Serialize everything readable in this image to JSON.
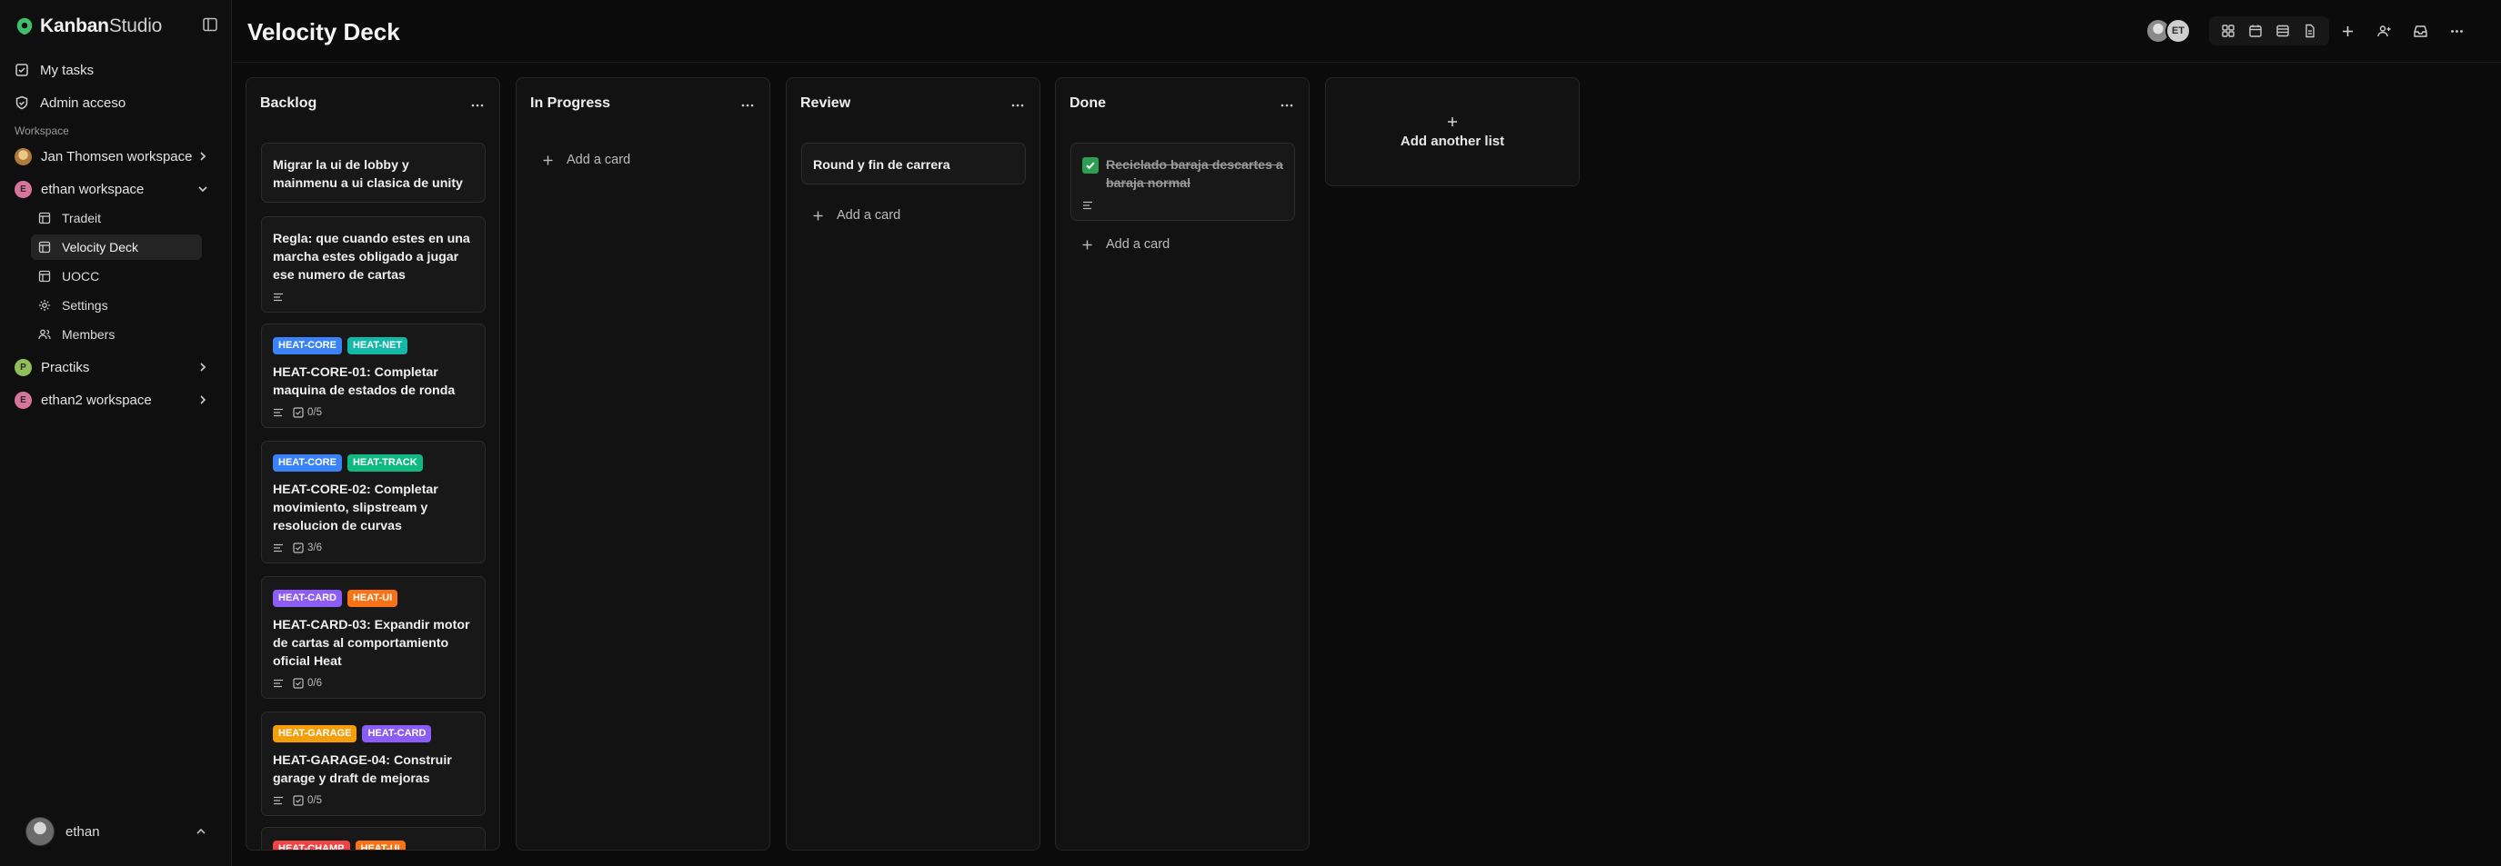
{
  "app": {
    "brand_bold": "Kanban",
    "brand_light": "Studio"
  },
  "sidebar": {
    "nav": [
      {
        "label": "My tasks",
        "icon": "check-square-icon"
      },
      {
        "label": "Admin acceso",
        "icon": "shield-icon"
      }
    ],
    "section_label": "Workspace",
    "workspaces": [
      {
        "label": "Jan Thomsen workspace",
        "initial": "",
        "color": "#d9a85b"
      },
      {
        "label": "ethan workspace",
        "initial": "E",
        "color": "#d8769a",
        "expanded": true
      },
      {
        "label": "Practiks",
        "initial": "P",
        "color": "#8fbf5a"
      },
      {
        "label": "ethan2 workspace",
        "initial": "E",
        "color": "#d8769a"
      }
    ],
    "sub_items": [
      {
        "label": "Tradeit",
        "icon": "board-icon"
      },
      {
        "label": "Velocity Deck",
        "icon": "board-icon",
        "active": true
      },
      {
        "label": "UOCC",
        "icon": "board-icon"
      },
      {
        "label": "Settings",
        "icon": "gear-icon"
      },
      {
        "label": "Members",
        "icon": "users-icon"
      }
    ],
    "user": {
      "name": "ethan"
    }
  },
  "topbar": {
    "title": "Velocity Deck",
    "avatars": [
      {
        "initials": ""
      },
      {
        "initials": "ET"
      }
    ]
  },
  "lists": [
    {
      "title": "Backlog",
      "cards": [
        {
          "title": "Migrar la ui de lobby y mainmenu a ui clasica de unity",
          "labels": []
        },
        {
          "title": "Regla: que cuando estes en una marcha estes obligado a jugar ese numero de cartas",
          "labels": [],
          "has_description": true
        },
        {
          "title": "HEAT-CORE-01: Completar maquina de estados de ronda",
          "labels": [
            {
              "text": "HEAT-CORE",
              "color": "#3b82f6"
            },
            {
              "text": "HEAT-NET",
              "color": "#14b8a6"
            }
          ],
          "has_description": true,
          "checklist": "0/5"
        },
        {
          "title": "HEAT-CORE-02: Completar movimiento, slipstream y resolucion de curvas",
          "labels": [
            {
              "text": "HEAT-CORE",
              "color": "#3b82f6"
            },
            {
              "text": "HEAT-TRACK",
              "color": "#10b981"
            }
          ],
          "has_description": true,
          "checklist": "3/6"
        },
        {
          "title": "HEAT-CARD-03: Expandir motor de cartas al comportamiento oficial Heat",
          "labels": [
            {
              "text": "HEAT-CARD",
              "color": "#8b5cf6"
            },
            {
              "text": "HEAT-UI",
              "color": "#f97316"
            }
          ],
          "has_description": true,
          "checklist": "0/6"
        },
        {
          "title": "HEAT-GARAGE-04: Construir garage y draft de mejoras",
          "labels": [
            {
              "text": "HEAT-GARAGE",
              "color": "#f59e0b"
            },
            {
              "text": "HEAT-CARD",
              "color": "#8b5cf6"
            }
          ],
          "has_description": true,
          "checklist": "0/5"
        },
        {
          "title": "",
          "labels": [
            {
              "text": "HEAT-CHAMP",
              "color": "#ef4444"
            },
            {
              "text": "HEAT-UI",
              "color": "#f97316"
            }
          ]
        }
      ]
    },
    {
      "title": "In Progress",
      "cards": [],
      "add_label": "Add a card"
    },
    {
      "title": "Review",
      "cards": [
        {
          "title": "Round y fin de carrera"
        }
      ],
      "add_label": "Add a card"
    },
    {
      "title": "Done",
      "cards": [
        {
          "title": "Reciclado baraja descartes a baraja normal",
          "done": true,
          "has_description": true
        }
      ],
      "add_label": "Add a card"
    }
  ],
  "add_list_label": "Add another list"
}
